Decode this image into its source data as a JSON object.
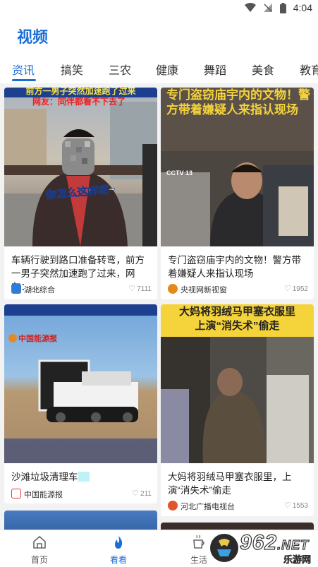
{
  "status": {
    "time": "4:04"
  },
  "header": {
    "title": "视频"
  },
  "tabs": [
    {
      "label": "资讯",
      "active": true
    },
    {
      "label": "搞笑"
    },
    {
      "label": "三农"
    },
    {
      "label": "健康"
    },
    {
      "label": "舞蹈"
    },
    {
      "label": "美食"
    },
    {
      "label": "教育"
    }
  ],
  "cards": [
    {
      "thumb_caption_top": "前方一男子突然加速跑了过来",
      "thumb_caption_sub": "网友：同伴都看不下去了",
      "thumb_caption_center": "你怎么这样呢~",
      "title": "车辆行驶到路口准备转弯，前方一男子突然加速跑了过来，网友：…",
      "source": "湖北综合",
      "likes": "7111"
    },
    {
      "thumb_caption_top": "专门盗窃庙宇内的文物！警方带着嫌疑人来指认现场",
      "thumb_badge": "CCTV 13",
      "title": "专门盗窃庙宇内的文物！警方带着嫌疑人来指认现场",
      "source": "央视网新视窗",
      "likes": "1952"
    },
    {
      "thumb_logo": "中国能源报",
      "title": "沙滩垃圾清理车",
      "source": "中国能源报",
      "likes": "211"
    },
    {
      "thumb_caption_top": "大妈将羽绒马甲塞衣服里",
      "thumb_caption_sub": "上演“消失术”偷走",
      "title": "大妈将羽绒马甲塞衣服里，上演“消失术”偷走",
      "source": "河北广播电视台",
      "likes": "1553"
    }
  ],
  "bottom_nav": [
    {
      "label": "首页",
      "icon": "home-icon"
    },
    {
      "label": "看看",
      "icon": "flame-icon",
      "active": true
    },
    {
      "label": "生活",
      "icon": "cup-icon"
    }
  ],
  "watermark": {
    "text": "962",
    "suffix": ".NET",
    "sub": "乐游网"
  },
  "colors": {
    "accent": "#1a6fd6",
    "caption_yellow": "#f5d33a"
  }
}
